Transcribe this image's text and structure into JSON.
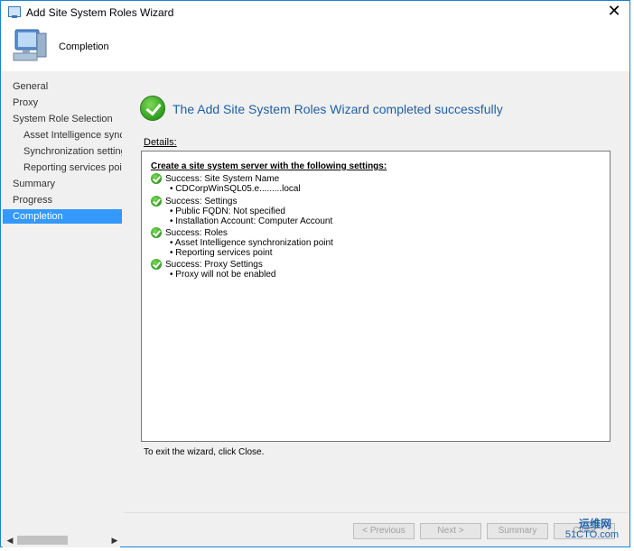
{
  "window": {
    "title": "Add Site System Roles Wizard",
    "close_glyph": "✕",
    "page_heading": "Completion"
  },
  "nav": {
    "items": [
      {
        "label": "General",
        "level": 0,
        "active": false
      },
      {
        "label": "Proxy",
        "level": 0,
        "active": false
      },
      {
        "label": "System Role Selection",
        "level": 0,
        "active": false
      },
      {
        "label": "Asset Intelligence synchro",
        "level": 1,
        "active": false
      },
      {
        "label": "Synchronization settings",
        "level": 1,
        "active": false
      },
      {
        "label": "Reporting services point",
        "level": 1,
        "active": false
      },
      {
        "label": "Summary",
        "level": 0,
        "active": false
      },
      {
        "label": "Progress",
        "level": 0,
        "active": false
      },
      {
        "label": "Completion",
        "level": 0,
        "active": true
      }
    ]
  },
  "main": {
    "success_title": "The Add Site System Roles Wizard completed successfully",
    "details_label": "Details:",
    "details": {
      "header": "Create a site system server with the following settings:",
      "sections": [
        {
          "title": "Success: Site System Name",
          "bullets": [
            "CDCorpWinSQL05.e.........local"
          ]
        },
        {
          "title": "Success: Settings",
          "bullets": [
            "Public FQDN: Not specified",
            "Installation Account: Computer Account"
          ]
        },
        {
          "title": "Success: Roles",
          "bullets": [
            "Asset Intelligence synchronization point",
            "Reporting services point"
          ]
        },
        {
          "title": "Success: Proxy Settings",
          "bullets": [
            "Proxy will not be enabled"
          ]
        }
      ]
    },
    "exit_text": "To exit the wizard, click Close."
  },
  "footer": {
    "previous": "< Previous",
    "next": "Next >",
    "summary": "Summary",
    "close": "Close"
  },
  "watermark": {
    "top": "运维网",
    "bottom": "51CTO.com"
  },
  "colors": {
    "accent": "#3399ff",
    "title_blue": "#1e5fa8",
    "success_green": "#2e9d1e"
  }
}
